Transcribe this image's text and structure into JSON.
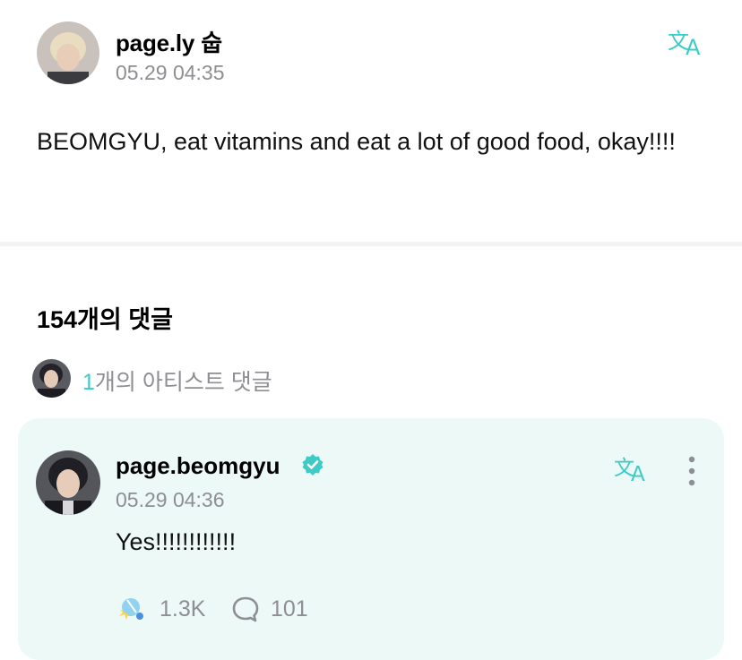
{
  "post": {
    "author": "page.ly 숩",
    "timestamp": "05.29 04:35",
    "body": "BEOMGYU, eat vitamins and eat a lot of good food, okay!!!!",
    "translate_icon": "translate-icon"
  },
  "comments": {
    "count_label": "154개의 댓글",
    "artist_count": "1",
    "artist_label_suffix": "개의 아티스트 댓글"
  },
  "artist_comment": {
    "author": "page.beomgyu",
    "verified_icon": "verified-badge-icon",
    "timestamp": "05.29 04:36",
    "body": "Yes!!!!!!!!!!!!",
    "likes": "1.3K",
    "replies": "101",
    "translate_icon": "translate-icon",
    "more_icon": "more-vertical-icon"
  },
  "colors": {
    "accent": "#3ccbc6",
    "card_background": "#ecf9f7",
    "muted_text": "#8e8e93"
  }
}
